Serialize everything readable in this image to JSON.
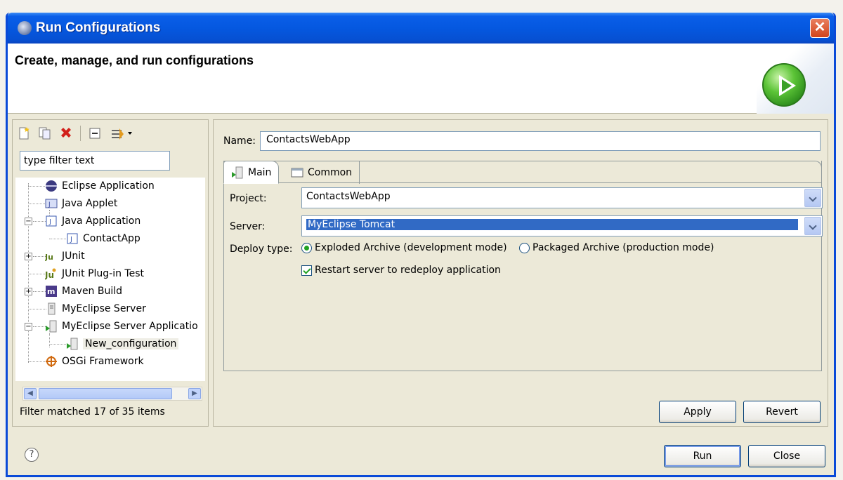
{
  "window": {
    "title": "Run Configurations",
    "banner_title": "Create, manage, and run configurations",
    "close_glyph": "✕"
  },
  "left": {
    "filter_placeholder": "type filter text",
    "filter_value": "type filter text",
    "status": "Filter matched 17 of 35 items",
    "tree": [
      {
        "label": "Eclipse Application",
        "icon": "eclipse-app-icon"
      },
      {
        "label": "Java Applet",
        "icon": "java-applet-icon"
      },
      {
        "label": "Java Application",
        "icon": "java-app-icon",
        "expanded": true
      },
      {
        "label": "ContactApp",
        "icon": "java-class-icon"
      },
      {
        "label": "JUnit",
        "icon": "junit-icon",
        "collapsed": true
      },
      {
        "label": "JUnit Plug-in Test",
        "icon": "junit-plugin-icon"
      },
      {
        "label": "Maven Build",
        "icon": "maven-icon",
        "collapsed": true
      },
      {
        "label": "MyEclipse Server",
        "icon": "server-icon"
      },
      {
        "label": "MyEclipse Server Applicatio",
        "icon": "server-app-icon",
        "expanded": true
      },
      {
        "label": "New_configuration",
        "icon": "server-app-icon",
        "selected": true
      },
      {
        "label": "OSGi Framework",
        "icon": "osgi-icon"
      }
    ]
  },
  "right": {
    "name_label": "Name:",
    "name_value": "ContactsWebApp",
    "tabs": [
      {
        "label": "Main",
        "active": true
      },
      {
        "label": "Common",
        "active": false
      }
    ],
    "project_label": "Project:",
    "project_value": "ContactsWebApp",
    "server_label": "Server:",
    "server_value": "MyEclipse Tomcat",
    "deploy_label": "Deploy type:",
    "deploy_option_exploded": "Exploded Archive (development mode)",
    "deploy_option_packaged": "Packaged Archive (production mode)",
    "restart_label": "Restart server to redeploy application",
    "apply_label": "Apply",
    "revert_label": "Revert"
  },
  "footer": {
    "help_glyph": "?",
    "run_label": "Run",
    "close_label": "Close"
  },
  "colors": {
    "titlebar": "#0558e0",
    "selection": "#316ac5",
    "radio_check": "#21a121"
  }
}
